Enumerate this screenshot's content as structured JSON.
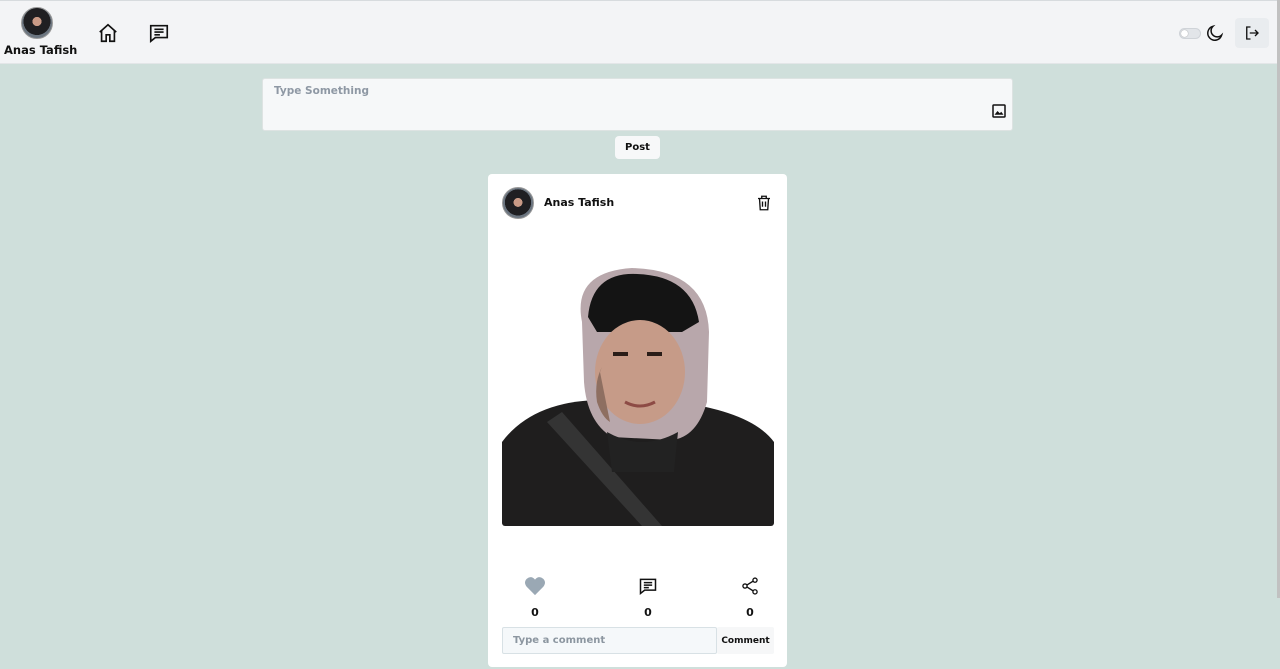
{
  "header": {
    "user_name": "Anas Tafish",
    "avatar_icon": "user-avatar",
    "nav": [
      {
        "name": "home",
        "icon": "home-icon"
      },
      {
        "name": "messages",
        "icon": "message-square-icon"
      }
    ],
    "theme_toggle": {
      "state": "off",
      "icon": "moon-icon"
    },
    "logout_icon": "logout-icon"
  },
  "composer": {
    "placeholder": "Type Something",
    "image_icon": "image-icon",
    "post_label": "Post"
  },
  "post": {
    "author_name": "Anas Tafish",
    "delete_icon": "trash-icon",
    "photo_alt": "profile photo",
    "likes": "0",
    "comments": "0",
    "shares": "0",
    "comment_placeholder": "Type a comment",
    "comment_button_label": "Comment"
  },
  "colors": {
    "page_bg": "#cfdfdb",
    "topbar_bg": "#f3f4f6",
    "like_color": "#9aa8b4"
  }
}
